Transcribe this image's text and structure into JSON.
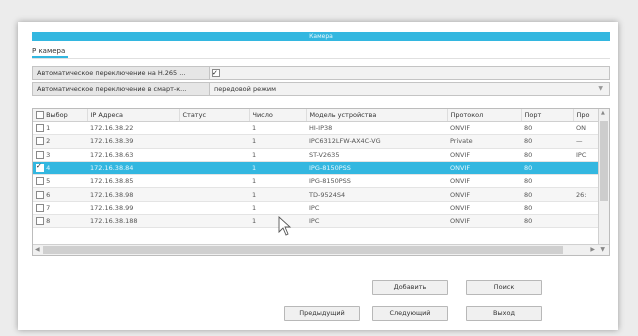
{
  "window": {
    "title": "Камера"
  },
  "tab": {
    "label": "Р камера"
  },
  "options": [
    {
      "label": "Автоматическое переключение на H.265 ...",
      "checked": true
    },
    {
      "label": "Автоматическое переключение в смарт-к...",
      "value": "передовой режим"
    }
  ],
  "grid": {
    "columns": [
      "Выбор",
      "IP Адреса",
      "Статус",
      "Число",
      "Модель устройства",
      "Протокол",
      "Порт",
      "Про"
    ],
    "rows": [
      {
        "num": "1",
        "ip": "172.16.38.22",
        "status": "",
        "count": "1",
        "model": "HI-IP38",
        "protocol": "ONVIF",
        "port": "80",
        "extra": "ON",
        "checked": false,
        "selected": false
      },
      {
        "num": "2",
        "ip": "172.16.38.39",
        "status": "",
        "count": "1",
        "model": "IPC6312LFW-AX4C-VG",
        "protocol": "Private",
        "port": "80",
        "extra": "—",
        "checked": false,
        "selected": false
      },
      {
        "num": "3",
        "ip": "172.16.38.63",
        "status": "",
        "count": "1",
        "model": "ST-V2635",
        "protocol": "ONVIF",
        "port": "80",
        "extra": "IPC",
        "checked": false,
        "selected": false
      },
      {
        "num": "4",
        "ip": "172.16.38.84",
        "status": "",
        "count": "1",
        "model": "IPG-8150PSS",
        "protocol": "ONVIF",
        "port": "80",
        "extra": "",
        "checked": true,
        "selected": true
      },
      {
        "num": "5",
        "ip": "172.16.38.85",
        "status": "",
        "count": "1",
        "model": "IPG-8150PSS",
        "protocol": "ONVIF",
        "port": "80",
        "extra": "",
        "checked": false,
        "selected": false
      },
      {
        "num": "6",
        "ip": "172.16.38.98",
        "status": "",
        "count": "1",
        "model": "TD-9524S4",
        "protocol": "ONVIF",
        "port": "80",
        "extra": "26:",
        "checked": false,
        "selected": false
      },
      {
        "num": "7",
        "ip": "172.16.38.99",
        "status": "",
        "count": "1",
        "model": "IPC",
        "protocol": "ONVIF",
        "port": "80",
        "extra": "",
        "checked": false,
        "selected": false
      },
      {
        "num": "8",
        "ip": "172.16.38.188",
        "status": "",
        "count": "1",
        "model": "IPC",
        "protocol": "ONVIF",
        "port": "80",
        "extra": "",
        "checked": false,
        "selected": false
      }
    ]
  },
  "buttons": {
    "add": "Добавить",
    "search": "Поиск",
    "prev": "Предыдущий",
    "next": "Следующий",
    "exit": "Выход"
  },
  "colors": {
    "accent": "#33b7e0"
  }
}
